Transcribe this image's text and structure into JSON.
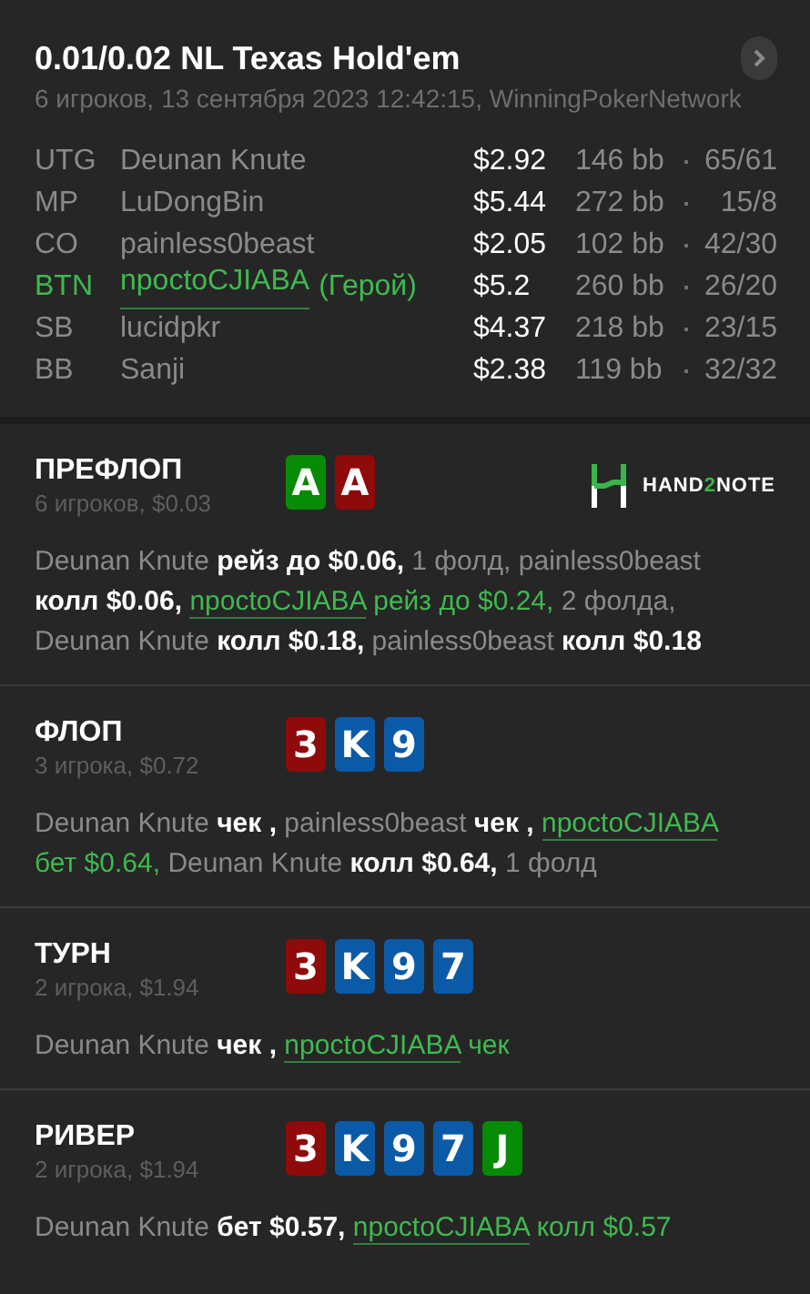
{
  "hand": {
    "title": "0.01/0.02 NL Texas Hold'em",
    "subtitle": "6 игроков, 13 сентября 2023 12:42:15, WinningPokerNetwork"
  },
  "players": [
    {
      "position": "UTG",
      "name": "Deunan Knute",
      "stack": "$2.92",
      "bb": "146 bb",
      "stats": "65/61",
      "hero": false
    },
    {
      "position": "MP",
      "name": "LuDongBin",
      "stack": "$5.44",
      "bb": "272 bb",
      "stats": "15/8",
      "hero": false
    },
    {
      "position": "CO",
      "name": "painless0beast",
      "stack": "$2.05",
      "bb": "102 bb",
      "stats": "42/30",
      "hero": false
    },
    {
      "position": "BTN",
      "name": "npoctoCJIABA",
      "hero_tag": "(Герой)",
      "stack": "$5.2",
      "bb": "260 bb",
      "stats": "26/20",
      "hero": true
    },
    {
      "position": "SB",
      "name": "lucidpkr",
      "stack": "$4.37",
      "bb": "218 bb",
      "stats": "23/15",
      "hero": false
    },
    {
      "position": "BB",
      "name": "Sanji",
      "stack": "$2.38",
      "bb": "119 bb",
      "stats": "32/32",
      "hero": false
    }
  ],
  "logo": {
    "prefix": "HAND",
    "accent": "2",
    "suffix": "NOTE"
  },
  "streets": [
    {
      "title": "ПРЕФЛОП",
      "subtitle": "6 игроков, $0.03",
      "cards": [
        {
          "rank": "A",
          "color": "#078b07"
        },
        {
          "rank": "A",
          "color": "#8f0a0a"
        }
      ],
      "actions": [
        {
          "kind": "player",
          "text": "Deunan Knute"
        },
        {
          "kind": "action",
          "text": "рейз до $0.06,"
        },
        {
          "kind": "note",
          "text": "1 фолд,"
        },
        {
          "kind": "player",
          "text": "painless0beast"
        },
        {
          "kind": "action",
          "text": "колл $0.06,"
        },
        {
          "kind": "hero",
          "text": "npoctoCJIABA"
        },
        {
          "kind": "hero_action",
          "text": "рейз до $0.24,"
        },
        {
          "kind": "note",
          "text": "2 фолда,"
        },
        {
          "kind": "player",
          "text": "Deunan Knute"
        },
        {
          "kind": "action",
          "text": "колл $0.18,"
        },
        {
          "kind": "player",
          "text": "painless0beast"
        },
        {
          "kind": "action",
          "text": "колл $0.18"
        }
      ]
    },
    {
      "title": "ФЛОП",
      "subtitle": "3 игрока, $0.72",
      "cards": [
        {
          "rank": "3",
          "color": "#8f0a0a"
        },
        {
          "rank": "K",
          "color": "#0b5aa8"
        },
        {
          "rank": "9",
          "color": "#0b5aa8"
        }
      ],
      "actions": [
        {
          "kind": "player",
          "text": "Deunan Knute"
        },
        {
          "kind": "action",
          "text": "чек ,"
        },
        {
          "kind": "player",
          "text": "painless0beast"
        },
        {
          "kind": "action",
          "text": "чек ,"
        },
        {
          "kind": "hero",
          "text": "npoctoCJIABA"
        },
        {
          "kind": "hero_action",
          "text": "бет $0.64,"
        },
        {
          "kind": "player",
          "text": "Deunan Knute"
        },
        {
          "kind": "action",
          "text": "колл $0.64,"
        },
        {
          "kind": "note",
          "text": "1 фолд"
        }
      ]
    },
    {
      "title": "ТУРН",
      "subtitle": "2 игрока, $1.94",
      "cards": [
        {
          "rank": "3",
          "color": "#8f0a0a"
        },
        {
          "rank": "K",
          "color": "#0b5aa8"
        },
        {
          "rank": "9",
          "color": "#0b5aa8"
        },
        {
          "rank": "7",
          "color": "#0b5aa8"
        }
      ],
      "actions": [
        {
          "kind": "player",
          "text": "Deunan Knute"
        },
        {
          "kind": "action",
          "text": "чек ,"
        },
        {
          "kind": "hero",
          "text": "npoctoCJIABA"
        },
        {
          "kind": "hero_action",
          "text": "чек"
        }
      ]
    },
    {
      "title": "РИВЕР",
      "subtitle": "2 игрока, $1.94",
      "cards": [
        {
          "rank": "3",
          "color": "#8f0a0a"
        },
        {
          "rank": "K",
          "color": "#0b5aa8"
        },
        {
          "rank": "9",
          "color": "#0b5aa8"
        },
        {
          "rank": "7",
          "color": "#0b5aa8"
        },
        {
          "rank": "J",
          "color": "#078b07"
        }
      ],
      "actions": [
        {
          "kind": "player",
          "text": "Deunan Knute"
        },
        {
          "kind": "action",
          "text": "бет $0.57,"
        },
        {
          "kind": "hero",
          "text": "npoctoCJIABA"
        },
        {
          "kind": "hero_action",
          "text": "колл $0.57"
        }
      ]
    }
  ]
}
